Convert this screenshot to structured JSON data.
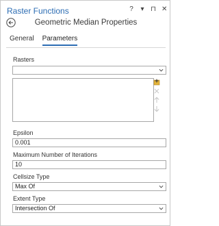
{
  "window": {
    "title": "Raster Functions",
    "controls": [
      "?",
      "▾",
      "⊓",
      "✕"
    ]
  },
  "header": {
    "subtitle": "Geometric Median Properties"
  },
  "tabs": [
    {
      "label": "General",
      "active": false
    },
    {
      "label": "Parameters",
      "active": true
    }
  ],
  "params": {
    "rasters_label": "Rasters",
    "rasters_value": "",
    "epsilon_label": "Epsilon",
    "epsilon_value": "0.001",
    "max_iter_label": "Maximum Number of Iterations",
    "max_iter_value": "10",
    "cellsize_label": "Cellsize Type",
    "cellsize_value": "Max Of",
    "extent_label": "Extent Type",
    "extent_value": "Intersection Of"
  },
  "list_icons": [
    "add-icon",
    "remove-icon",
    "move-up-icon",
    "move-down-icon"
  ],
  "colors": {
    "accent": "#2b6cb3",
    "border": "#a7a7a7",
    "add_icon": "#e4b43a",
    "disabled_icon": "#c9c9c9"
  }
}
